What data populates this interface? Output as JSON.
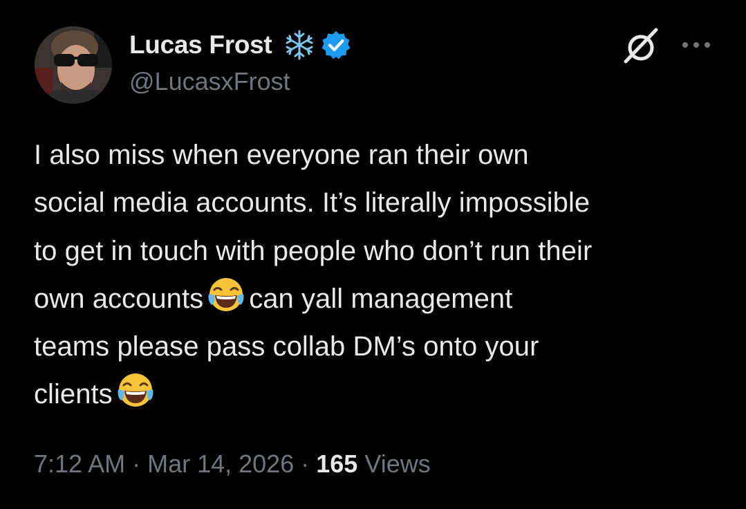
{
  "author": {
    "display_name": "Lucas Frost",
    "handle": "@LucasxFrost",
    "name_decoration_icon": "snowflake-icon",
    "verified_icon": "verified-badge-icon",
    "verified_color": "#1d9bf0"
  },
  "header_actions": {
    "grok_icon": "grok-icon",
    "more_icon": "more-options-icon"
  },
  "tweet": {
    "lines": {
      "l1": "I also miss when everyone ran their own",
      "l2": "social media accounts. It’s literally impossible",
      "l3": "to get in touch with people who don’t run their",
      "l4a": "own accounts",
      "l4b": "can yall management",
      "l5": "teams please pass collab DM’s onto your",
      "l6": "clients"
    },
    "emoji": "face-with-tears-of-joy"
  },
  "meta": {
    "time": "7:12 AM",
    "separator": "·",
    "date": "Mar 14, 2026",
    "views_count": "165",
    "views_label": "Views"
  },
  "colors": {
    "background": "#000000",
    "primary_text": "#e7e9ea",
    "secondary_text": "#71767b",
    "accent_blue": "#1d9bf0",
    "snowflake": "#7cc4ea"
  }
}
